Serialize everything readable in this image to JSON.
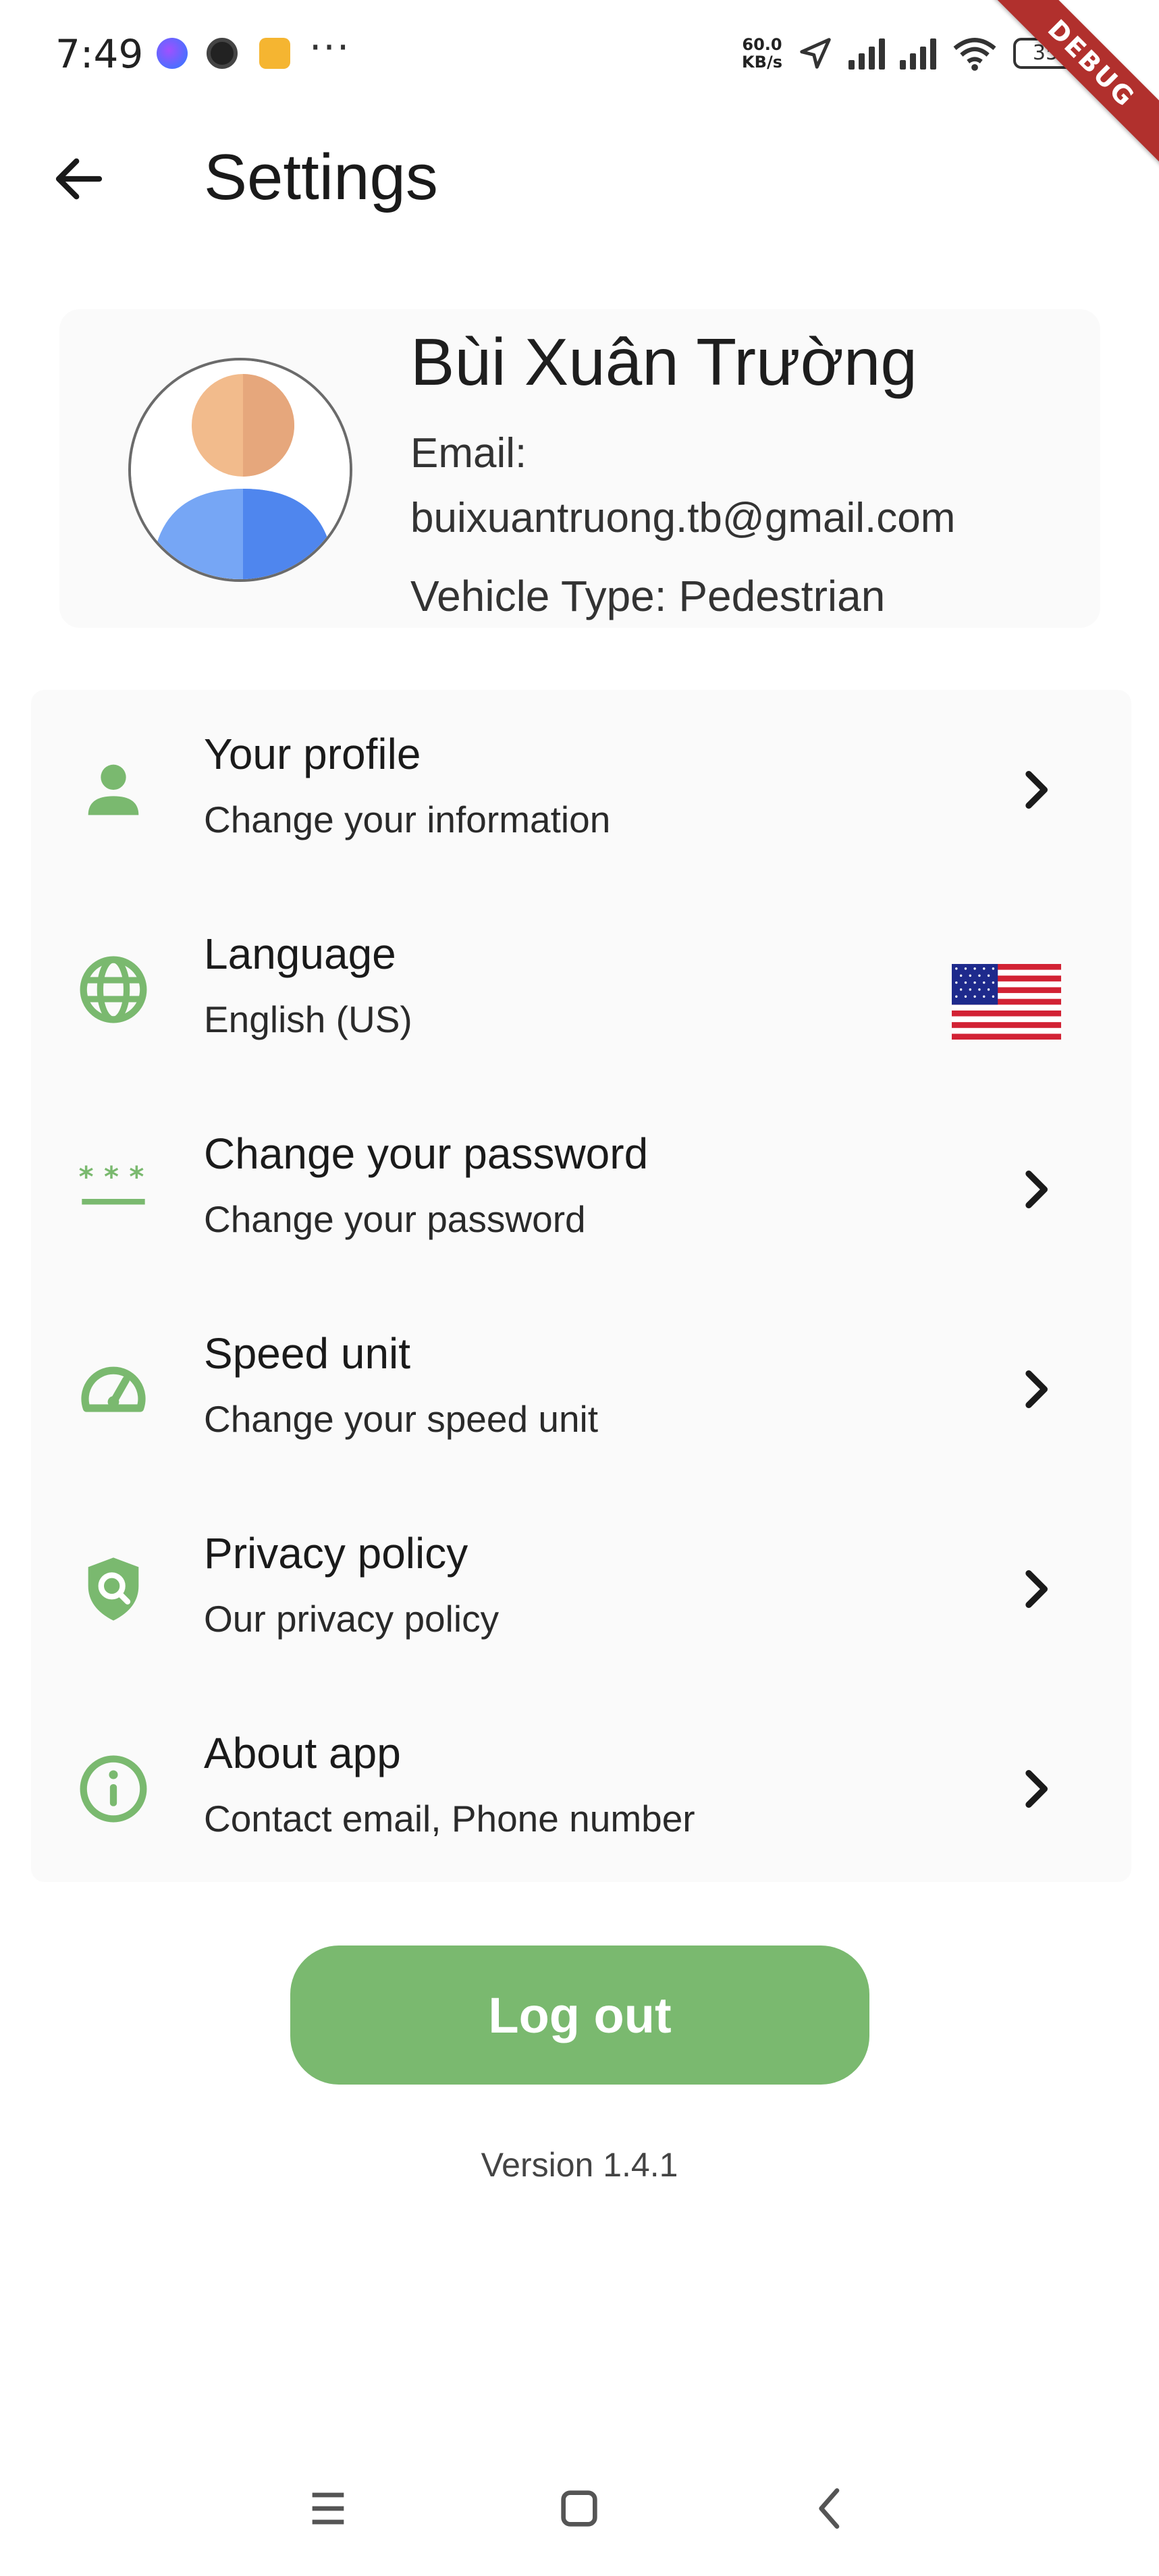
{
  "status_bar": {
    "time": "7:49",
    "network_speed_value": "60.0",
    "network_speed_unit": "KB/s",
    "battery": "35",
    "debug_label": "DEBUG",
    "more_label": "···"
  },
  "app_bar": {
    "title": "Settings"
  },
  "profile": {
    "name": "Bùi Xuân Trường",
    "email_label": "Email:",
    "email": "buixuantruong.tb@gmail.com",
    "vehicle": "Vehicle Type: Pedestrian"
  },
  "settings": {
    "items": [
      {
        "title": "Your profile",
        "subtitle": "Change your information",
        "icon": "person-icon"
      },
      {
        "title": "Language",
        "subtitle": "English (US)",
        "icon": "globe-icon"
      },
      {
        "title": "Change your password",
        "subtitle": "Change your password",
        "icon": "password-icon"
      },
      {
        "title": "Speed unit",
        "subtitle": "Change your speed unit",
        "icon": "speedometer-icon"
      },
      {
        "title": "Privacy policy",
        "subtitle": "Our privacy policy",
        "icon": "shield-search-icon"
      },
      {
        "title": "About app",
        "subtitle": "Contact email, Phone number",
        "icon": "info-icon"
      }
    ]
  },
  "logout": {
    "label": "Log out"
  },
  "footer": {
    "version": "Version 1.4.1"
  },
  "colors": {
    "accent": "#7ab96f",
    "card_background": "#fafafa",
    "debug_ribbon": "#b1302d"
  }
}
